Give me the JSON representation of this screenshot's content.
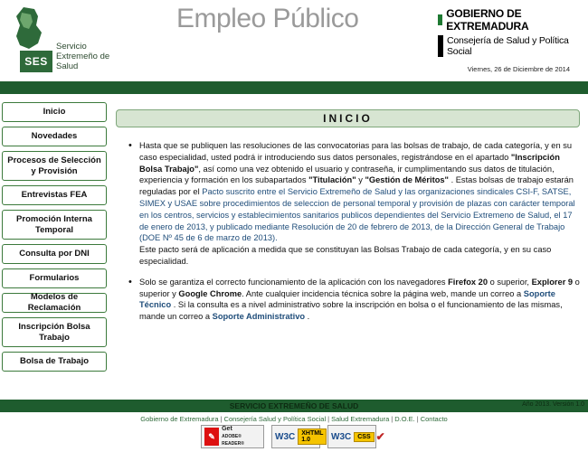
{
  "header": {
    "logo_abbr": "SES",
    "logo_text": "Servicio Extremeño de Salud",
    "site_title": "Empleo Público",
    "gov_title": "GOBIERNO DE EXTREMADURA",
    "gov_subtitle": "Consejería de Salud y Política Social",
    "date": "Viernes, 26 de Diciembre de 2014"
  },
  "sidebar": {
    "items": [
      {
        "label": "Inicio"
      },
      {
        "label": "Novedades"
      },
      {
        "label": "Procesos de Selección y Provisión"
      },
      {
        "label": "Entrevistas FEA"
      },
      {
        "label": "Promoción Interna Temporal"
      },
      {
        "label": "Consulta por DNI"
      },
      {
        "label": "Formularios"
      },
      {
        "label": "Modelos de Reclamación"
      },
      {
        "label": "Inscripción Bolsa Trabajo"
      },
      {
        "label": "Bolsa de Trabajo"
      }
    ]
  },
  "main": {
    "title": "INICIO",
    "p1": {
      "t1": "Hasta que se publiquen las resoluciones de las convocatorias para las bolsas de trabajo, de cada categoría, y en su caso especialidad, usted podrá ir introduciendo sus datos personales, registrándose en el apartado ",
      "b1": "\"Inscripción Bolsa Trabajo\"",
      "t2": ", así como una vez obtenido el usuario y contraseña, ir cumplimentando sus datos de titulación, experiencia y formación en los subapartados ",
      "b2": "\"Titulación\"",
      "t3": " y ",
      "b3": "\"Gestión de Méritos\"",
      "t4": " . Estas bolsas de trabajo estarán reguladas por el ",
      "link": "Pacto suscrito entre el Servicio Extremeño de Salud y las organizaciones sindicales CSI-F, SATSE, SIMEX y USAE sobre procedimientos de seleccion de personal temporal y provisión de plazas con carácter temporal en los centros, servicios y establecimientos sanitarios publicos dependientes del Servicio Extremeno de Salud, el 17 de enero de 2013, y publicado mediante Resolución de 20 de febrero de 2013, de la Dirección General de Trabajo (DOE Nº 45 de 6 de marzo de 2013).",
      "t5": "Este pacto será de aplicación a medida que se constituyan las Bolsas Trabajo de cada categoría, y en su caso especialidad."
    },
    "p2": {
      "t1": "Solo se garantiza el correcto funcionamiento de la aplicación con los navegadores ",
      "b1": "Firefox 20",
      "t2": " o superior, ",
      "b2": "Explorer 9",
      "t3": " o superior y ",
      "b3": "Google Chrome",
      "t4": ". Ante cualquier incidencia técnica sobre la página web, mande un correo a ",
      "link1": "Soporte Técnico",
      "t5": " . Si la consulta es a nivel administrativo sobre la inscripción en bolsa o el funcionamiento de las mismas, mande un correo a ",
      "link2": "Soporte Administrativo",
      "t6": " ."
    }
  },
  "footer": {
    "title": "SERVICIO EXTREMEÑO DE SALUD",
    "year": "Año 2013. Versión 1.0",
    "links": [
      "Gobierno de Extremadura",
      "Consejería Salud y Política Social",
      "Salud Extremadura",
      "D.O.E.",
      "Contacto"
    ],
    "badges": {
      "adobe_get": "Get",
      "adobe_reader": "ADOBE® READER®",
      "w3c": "W3C",
      "xhtml": "XHTML 1.0",
      "css": "CSS"
    }
  },
  "colors": {
    "brand_green": "#1e5c2e",
    "nav_border": "#3c7a3c",
    "title_bg": "#d7e5d2",
    "link": "#1f4d7a"
  }
}
